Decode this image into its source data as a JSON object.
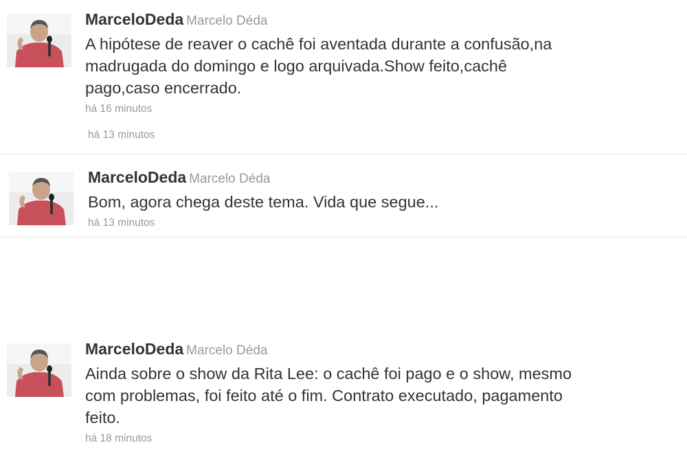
{
  "tweets": [
    {
      "screen_name": "MarceloDeda",
      "full_name": "Marcelo Déda",
      "text_lines": [
        "A hipótese de reaver o cachê foi aventada durante a confusão,na",
        "madrugada do domingo e logo arquivada.Show feito,cachê",
        "pago,caso encerrado."
      ],
      "timestamp": "há 16 minutos"
    },
    {
      "screen_name": "MarceloDeda",
      "full_name": "Marcelo Déda",
      "text_lines": [
        "Bom, agora chega deste tema. Vida que segue..."
      ],
      "timestamp": "há 13 minutos"
    },
    {
      "screen_name": "MarceloDeda",
      "full_name": "Marcelo Déda",
      "text_lines": [
        "Ainda sobre o show da Rita Lee: o cachê foi pago e o show, mesmo",
        "com problemas, foi feito até o fim. Contrato executado, pagamento",
        "feito."
      ],
      "timestamp": "há 18 minutos"
    }
  ],
  "orphan_timestamp": "há 13 minutos",
  "colors": {
    "text": "#333333",
    "muted": "#999999",
    "separator": "#e3e3e3",
    "shirt": "#c8505a"
  },
  "icons": {
    "avatar": "user-avatar-photo"
  }
}
